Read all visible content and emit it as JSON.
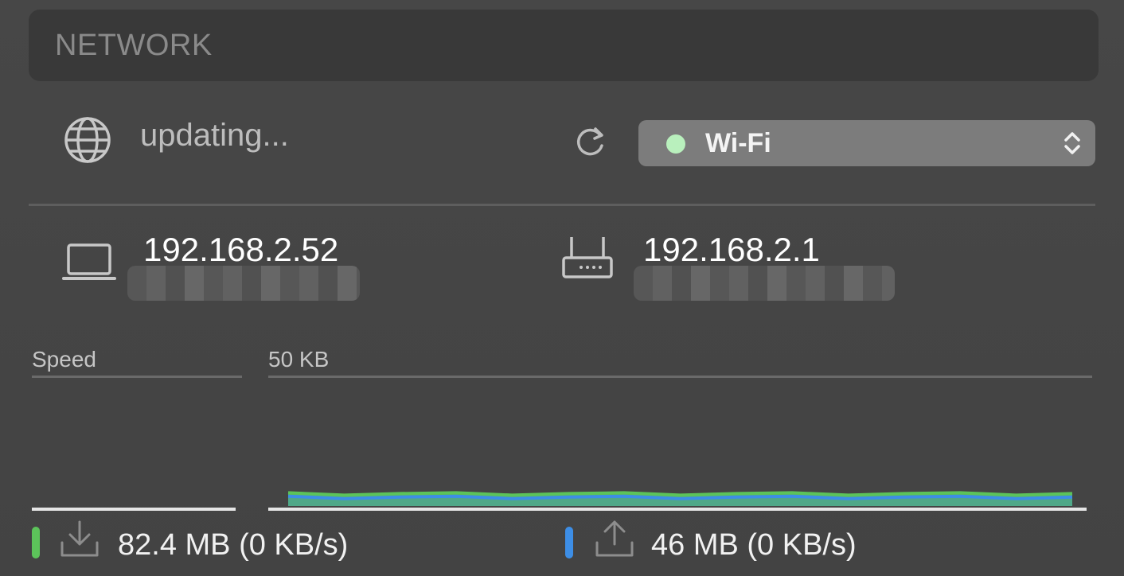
{
  "section": {
    "title": "NETWORK"
  },
  "status": {
    "text": "updating...",
    "globe_icon": "globe-icon",
    "refresh_icon": "refresh-icon"
  },
  "interface": {
    "selected": "Wi-Fi",
    "dot_color": "#b9f0bd",
    "arrows_icon": "chevron-updown-icon"
  },
  "local": {
    "ip": "192.168.2.52",
    "icon": "laptop-icon"
  },
  "router": {
    "ip": "192.168.2.1",
    "icon": "router-icon"
  },
  "speed": {
    "label": "Speed",
    "scale_max": "50 KB"
  },
  "chart_data": {
    "type": "area",
    "ylim": [
      0,
      50
    ],
    "series": [
      {
        "values": [
          0.2,
          0.2,
          0.2,
          0.2,
          0.2,
          0.2,
          0.2,
          0.2,
          0.2,
          0.2,
          0.2,
          0.2,
          0.2,
          0.2,
          0.2
        ],
        "color": "#5cc35a"
      },
      {
        "values": [
          0.1,
          0.1,
          0.1,
          0.1,
          0.1,
          0.1,
          0.1,
          0.1,
          0.1,
          0.1,
          0.1,
          0.1,
          0.1,
          0.1,
          0.1
        ],
        "color": "#3d8ee6"
      }
    ]
  },
  "download": {
    "text": "82.4 MB (0 KB/s)",
    "color": "#5cc35a",
    "icon": "download-icon"
  },
  "upload": {
    "text": "46 MB (0 KB/s)",
    "color": "#3d8ee6",
    "icon": "upload-icon"
  }
}
